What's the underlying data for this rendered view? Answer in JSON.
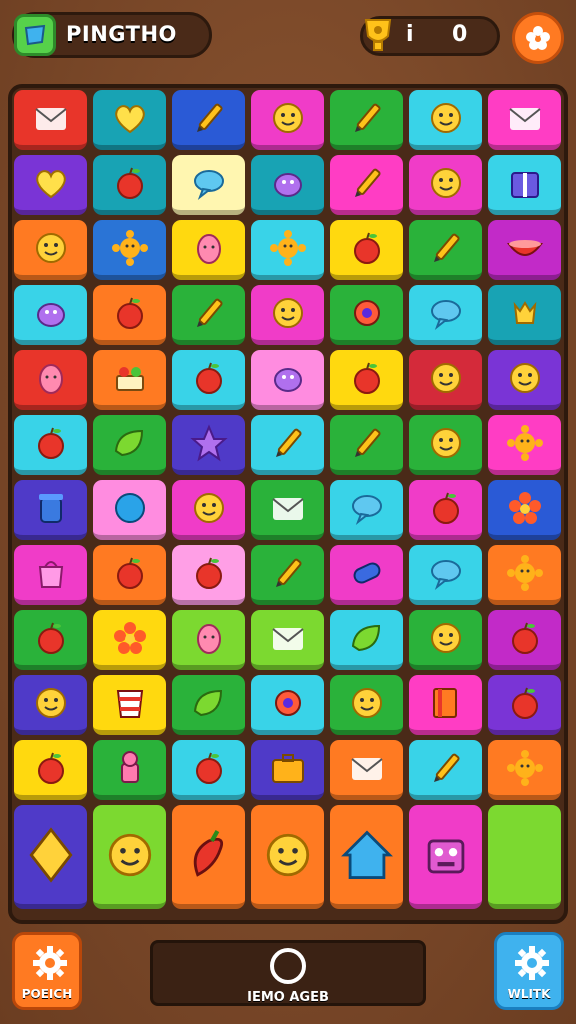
{
  "header": {
    "title": "PINGTHO",
    "score_separator": "i",
    "score_value": "0"
  },
  "colors": {
    "board": "#4a2a18",
    "accent_orange": "#ff7a22",
    "accent_blue": "#3fb2ee"
  },
  "board": {
    "rows": [
      [
        {
          "color": "#e8352a",
          "icon": "envelope-icon"
        },
        {
          "color": "#18a3b4",
          "icon": "heart-icon"
        },
        {
          "color": "#2a5ad6",
          "icon": "pencil-icon"
        },
        {
          "color": "#f03cc8",
          "icon": "smiley-icon"
        },
        {
          "color": "#2ab23a",
          "icon": "pencil-icon"
        },
        {
          "color": "#39d3e8",
          "icon": "smiley-icon"
        },
        {
          "color": "#ff3dc4",
          "icon": "envelope-icon"
        }
      ],
      [
        {
          "color": "#7a34d6",
          "icon": "heart-icon"
        },
        {
          "color": "#18a3b4",
          "icon": "apple-icon"
        },
        {
          "color": "#fff6b0",
          "icon": "speech-bubble-icon"
        },
        {
          "color": "#18a3b4",
          "icon": "creature-icon"
        },
        {
          "color": "#ff3dc4",
          "icon": "pencil-icon"
        },
        {
          "color": "#f03cc8",
          "icon": "smiley-icon"
        },
        {
          "color": "#39d3e8",
          "icon": "gift-box-icon"
        }
      ],
      [
        {
          "color": "#ff7a22",
          "icon": "smiley-icon"
        },
        {
          "color": "#2a74d6",
          "icon": "sun-icon"
        },
        {
          "color": "#ffd90f",
          "icon": "egg-icon"
        },
        {
          "color": "#39d3e8",
          "icon": "sun-icon"
        },
        {
          "color": "#ffd90f",
          "icon": "apple-icon"
        },
        {
          "color": "#2ab23a",
          "icon": "pencil-icon"
        },
        {
          "color": "#c22ac8",
          "icon": "bowl-icon"
        }
      ],
      [
        {
          "color": "#39d3e8",
          "icon": "creature-icon"
        },
        {
          "color": "#ff7a22",
          "icon": "apple-icon"
        },
        {
          "color": "#2ab23a",
          "icon": "pencil-icon"
        },
        {
          "color": "#f03cc8",
          "icon": "smiley-icon"
        },
        {
          "color": "#2ab23a",
          "icon": "gear-icon"
        },
        {
          "color": "#39d3e8",
          "icon": "speech-bubble-icon"
        },
        {
          "color": "#18a3b4",
          "icon": "tulip-icon"
        }
      ],
      [
        {
          "color": "#e8352a",
          "icon": "egg-icon"
        },
        {
          "color": "#ff7a22",
          "icon": "basket-icon"
        },
        {
          "color": "#39d3e8",
          "icon": "apple-icon"
        },
        {
          "color": "#ff8ce0",
          "icon": "creature-icon"
        },
        {
          "color": "#ffd90f",
          "icon": "apple-icon"
        },
        {
          "color": "#d42a3a",
          "icon": "smiley-icon"
        },
        {
          "color": "#7a34d6",
          "icon": "smiley-icon"
        }
      ],
      [
        {
          "color": "#39d3e8",
          "icon": "apple-icon"
        },
        {
          "color": "#2ab23a",
          "icon": "leaf-icon"
        },
        {
          "color": "#4f3ac8",
          "icon": "star-icon"
        },
        {
          "color": "#39d3e8",
          "icon": "pencil-icon"
        },
        {
          "color": "#2ab23a",
          "icon": "pencil-icon"
        },
        {
          "color": "#2ab23a",
          "icon": "smiley-icon"
        },
        {
          "color": "#ff3dc4",
          "icon": "sun-icon"
        }
      ],
      [
        {
          "color": "#4f3ac8",
          "icon": "jar-icon"
        },
        {
          "color": "#ff8ce0",
          "icon": "ball-icon"
        },
        {
          "color": "#f03cc8",
          "icon": "smiley-icon"
        },
        {
          "color": "#2ab23a",
          "icon": "envelope-icon"
        },
        {
          "color": "#39d3e8",
          "icon": "speech-bubble-icon"
        },
        {
          "color": "#f03cc8",
          "icon": "apple-icon"
        },
        {
          "color": "#2a5ad6",
          "icon": "flower-icon"
        }
      ],
      [
        {
          "color": "#f03cc8",
          "icon": "bag-icon"
        },
        {
          "color": "#ff7a22",
          "icon": "apple-icon"
        },
        {
          "color": "#ff9fe6",
          "icon": "apple-icon"
        },
        {
          "color": "#2ab23a",
          "icon": "pencil-icon"
        },
        {
          "color": "#f03cc8",
          "icon": "candy-icon"
        },
        {
          "color": "#39d3e8",
          "icon": "speech-bubble-icon"
        },
        {
          "color": "#ff7a22",
          "icon": "sun-icon"
        }
      ],
      [
        {
          "color": "#2ab23a",
          "icon": "apple-icon"
        },
        {
          "color": "#ffd90f",
          "icon": "flower-icon"
        },
        {
          "color": "#7cd930",
          "icon": "egg-icon"
        },
        {
          "color": "#7cd930",
          "icon": "envelope-icon"
        },
        {
          "color": "#39d3e8",
          "icon": "leaf-icon"
        },
        {
          "color": "#2ab23a",
          "icon": "smiley-icon"
        },
        {
          "color": "#c22ac8",
          "icon": "apple-icon"
        }
      ],
      [
        {
          "color": "#4f3ac8",
          "icon": "smiley-icon"
        },
        {
          "color": "#ffd90f",
          "icon": "cup-icon"
        },
        {
          "color": "#2ab23a",
          "icon": "leaf-icon"
        },
        {
          "color": "#39d3e8",
          "icon": "gear-icon"
        },
        {
          "color": "#2ab23a",
          "icon": "smiley-icon"
        },
        {
          "color": "#ff3dc4",
          "icon": "book-icon"
        },
        {
          "color": "#7a34d6",
          "icon": "apple-icon"
        }
      ],
      [
        {
          "color": "#ffd90f",
          "icon": "apple-icon"
        },
        {
          "color": "#2ab23a",
          "icon": "chef-icon"
        },
        {
          "color": "#39d3e8",
          "icon": "apple-icon"
        },
        {
          "color": "#4f3ac8",
          "icon": "suitcase-icon"
        },
        {
          "color": "#ff7a22",
          "icon": "envelope-icon"
        },
        {
          "color": "#39d3e8",
          "icon": "pencil-icon"
        },
        {
          "color": "#ff7a22",
          "icon": "sun-icon"
        }
      ],
      [
        {
          "color": "#4f3ac8",
          "icon": "diamond-icon"
        },
        {
          "color": "#7cd930",
          "icon": "smiley-icon"
        },
        {
          "color": "#ff7a22",
          "icon": "pepper-icon"
        },
        {
          "color": "#ff7a22",
          "icon": "smiley-icon"
        },
        {
          "color": "#ff7a22",
          "icon": "house-icon"
        },
        {
          "color": "#f03cc8",
          "icon": "robot-icon"
        },
        {
          "color": "#7cd930",
          "icon": ""
        }
      ]
    ]
  },
  "footer": {
    "left_label": "POEICH",
    "center_label": "IEMO AGEB",
    "right_label": "WLITK"
  }
}
